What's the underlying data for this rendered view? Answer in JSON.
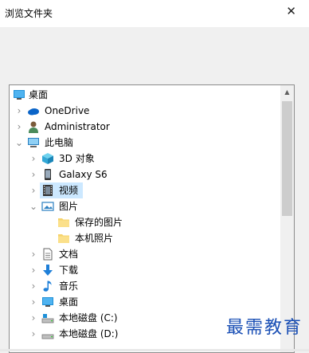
{
  "dialog": {
    "title": "浏览文件夹",
    "close_glyph": "✕"
  },
  "tree": {
    "desktop_root": "桌面",
    "onedrive": "OneDrive",
    "administrator": "Administrator",
    "this_pc": "此电脑",
    "objects3d": "3D 对象",
    "galaxy": "Galaxy S6",
    "videos": "视频",
    "pictures": "图片",
    "saved_pictures": "保存的图片",
    "camera_roll": "本机照片",
    "documents": "文档",
    "downloads": "下载",
    "music": "音乐",
    "desktop": "桌面",
    "local_c": "本地磁盘 (C:)",
    "local_d": "本地磁盘 (D:)"
  },
  "watermark": "最需教育",
  "icons": {
    "desktop": "desktop-icon",
    "onedrive": "cloud-icon",
    "user": "user-icon",
    "pc": "computer-icon",
    "objects": "cube-icon",
    "phone": "phone-icon",
    "video": "film-icon",
    "pictures": "picture-icon",
    "folder": "folder-icon",
    "document": "document-icon",
    "download": "download-arrow-icon",
    "music": "music-note-icon",
    "drive": "drive-icon"
  }
}
